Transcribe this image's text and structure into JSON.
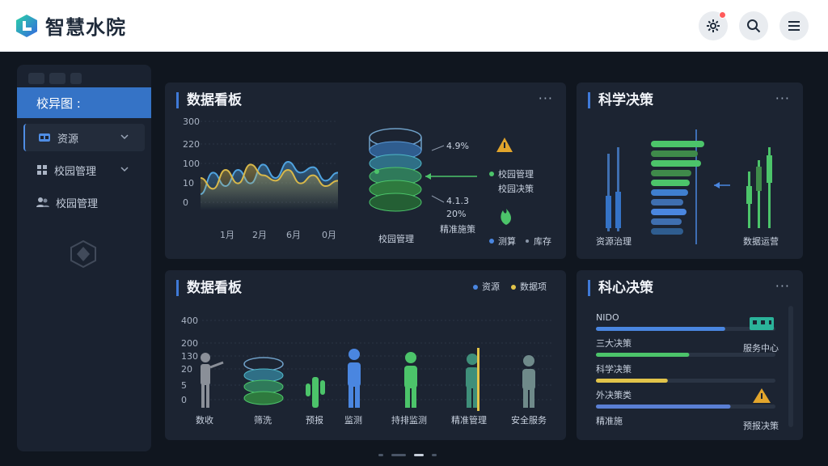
{
  "header": {
    "app_title": "智慧水院"
  },
  "sidebar": {
    "active_label": "校异图 :",
    "items": [
      {
        "label": "资源"
      },
      {
        "label": "校园管理"
      },
      {
        "label": "校园管理"
      }
    ]
  },
  "panel_tl": {
    "title": "数据看板",
    "more": "···",
    "y_ticks": [
      "300",
      "220",
      "100",
      "10",
      "0"
    ],
    "x_ticks": [
      "1月",
      "2月",
      "6月",
      "0月"
    ],
    "cylinder_annotations": [
      "4.9%",
      "4.1.3",
      "20%"
    ],
    "cylinder_label": "校园管理",
    "side_labels": [
      "校园管理",
      "校园决策",
      "精准施策"
    ],
    "legend": [
      "测算",
      "库存"
    ]
  },
  "panel_tr": {
    "title": "科学决策",
    "more": "···",
    "labels": [
      "资源治理",
      "数据运营"
    ]
  },
  "panel_bl": {
    "title": "数据看板",
    "more": "···",
    "legend": [
      "资源",
      "数据项"
    ],
    "y_ticks": [
      "400",
      "200",
      "130",
      "20",
      "5",
      "0"
    ],
    "figures": [
      "数收",
      "筛洗",
      "预报",
      "监测",
      "持排监测",
      "精准管理",
      "安全服务"
    ]
  },
  "panel_br": {
    "title": "科心决策",
    "more": "···",
    "rows": [
      {
        "label": "NIDO",
        "right": "",
        "progress": 0.72,
        "color": "#4a86e0"
      },
      {
        "label": "三大决策",
        "right": "服务中心",
        "progress": 0.52,
        "color": "#4cc46a"
      },
      {
        "label": "科学决策",
        "right": "",
        "progress": 0.4,
        "color": "#e2c44a"
      },
      {
        "label": "外决策类",
        "right": "",
        "progress": 0.75,
        "color": "#5a7fd4"
      },
      {
        "label": "精准施",
        "right": "预报决策",
        "progress": 0,
        "color": "#4a86e0"
      }
    ]
  },
  "chart_data": {
    "type": "area",
    "x": [
      "1月",
      "2月",
      "6月",
      "0月"
    ],
    "ylim": [
      0,
      300
    ],
    "series": [
      {
        "name": "",
        "values": [
          60,
          140,
          90,
          150,
          100,
          170,
          120,
          180,
          140,
          160,
          110,
          140
        ],
        "color": "#4fa3e0"
      },
      {
        "name": "",
        "values": [
          120,
          80,
          150,
          100,
          170,
          130,
          110,
          150,
          100,
          130,
          90,
          110
        ],
        "color": "#d8b84a"
      }
    ]
  },
  "colors": {
    "accent": "#3f7ad8",
    "green": "#4cc46a",
    "yellow": "#e2c44a",
    "blue": "#4a86e0"
  }
}
